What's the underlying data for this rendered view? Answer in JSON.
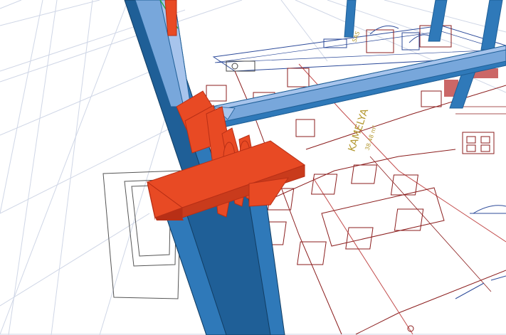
{
  "viewport": {
    "background": "#ffffff",
    "grid_color": "#cfd6e6"
  },
  "colors": {
    "steel_blue_dark": "#1f5f97",
    "steel_blue": "#2f79b9",
    "steel_blue_light": "#78a7db",
    "steel_blue_pale": "#a7c4ec",
    "connection_plate": "#e84a24",
    "connection_plate_dark": "#b82f16",
    "plan_lines": "#8b1d1d",
    "plan_lines_light": "#c24c4c",
    "plan_text": "#b59a34",
    "wall_outline": "#555555"
  },
  "plan_labels": {
    "room_name": "KAMELYA",
    "room_area": "38.48 m²",
    "small_label": "SAS"
  }
}
